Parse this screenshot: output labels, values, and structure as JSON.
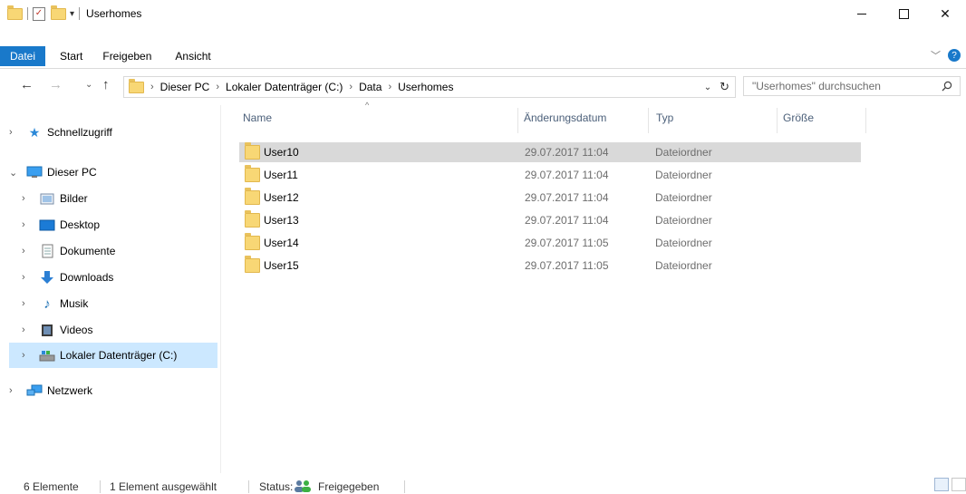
{
  "window": {
    "title": "Userhomes"
  },
  "ribbon": {
    "tabs": [
      "Datei",
      "Start",
      "Freigeben",
      "Ansicht"
    ]
  },
  "address": {
    "crumbs": [
      "Dieser PC",
      "Lokaler Datenträger (C:)",
      "Data",
      "Userhomes"
    ],
    "search_placeholder": "\"Userhomes\" durchsuchen"
  },
  "nav": {
    "items": [
      {
        "label": "Schnellzugriff",
        "icon": "star-icon"
      },
      {
        "label": "Dieser PC",
        "icon": "pc-icon"
      },
      {
        "label": "Bilder",
        "icon": "pictures-icon"
      },
      {
        "label": "Desktop",
        "icon": "desktop-icon"
      },
      {
        "label": "Dokumente",
        "icon": "documents-icon"
      },
      {
        "label": "Downloads",
        "icon": "download-icon"
      },
      {
        "label": "Musik",
        "icon": "music-icon"
      },
      {
        "label": "Videos",
        "icon": "video-icon"
      },
      {
        "label": "Lokaler Datenträger (C:)",
        "icon": "drive-icon"
      },
      {
        "label": "Netzwerk",
        "icon": "network-icon"
      }
    ],
    "selected": "Lokaler Datenträger (C:)"
  },
  "list": {
    "columns": [
      "Name",
      "Änderungsdatum",
      "Typ",
      "Größe"
    ],
    "rows": [
      {
        "name": "User10",
        "date": "29.07.2017 11:04",
        "type": "Dateiordner"
      },
      {
        "name": "User11",
        "date": "29.07.2017 11:04",
        "type": "Dateiordner"
      },
      {
        "name": "User12",
        "date": "29.07.2017 11:04",
        "type": "Dateiordner"
      },
      {
        "name": "User13",
        "date": "29.07.2017 11:04",
        "type": "Dateiordner"
      },
      {
        "name": "User14",
        "date": "29.07.2017 11:05",
        "type": "Dateiordner"
      },
      {
        "name": "User15",
        "date": "29.07.2017 11:05",
        "type": "Dateiordner"
      }
    ],
    "selected_row": "User10"
  },
  "status": {
    "count": "6 Elemente",
    "selection": "1 Element ausgewählt",
    "state_label": "Status:",
    "state_value": "Freigegeben"
  },
  "colors": {
    "accent": "#1979ca",
    "nav_selected": "#cce8ff",
    "row_selected": "#d9d9d9",
    "folder": "#f8d775"
  }
}
